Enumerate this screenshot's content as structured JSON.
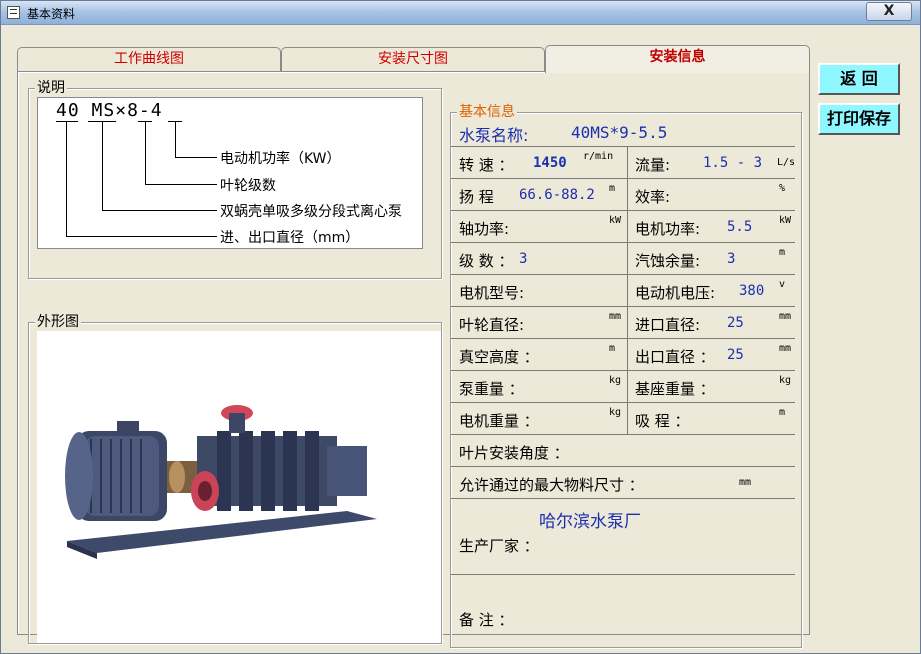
{
  "window": {
    "title": "基本资料",
    "close": "X"
  },
  "tabs": [
    {
      "label": "工作曲线图"
    },
    {
      "label": "安装尺寸图"
    },
    {
      "label": "安装信息"
    }
  ],
  "explain": {
    "label": "说明",
    "model": {
      "code_parts": [
        "40",
        "MS",
        "×",
        "8",
        "-",
        "4"
      ],
      "legend": [
        "电动机功率（KW）",
        "叶轮级数",
        "双蜗壳单吸多级分段式离心泵",
        "进、出口直径（mm）"
      ]
    }
  },
  "outline": {
    "label": "外形图"
  },
  "info": {
    "label": "基本信息",
    "pump_name_label": "水泵名称:",
    "pump_name_value": "40MS*9-5.5",
    "rows": [
      {
        "l_label": "转 速 ：",
        "l_value": "1450",
        "l_unit": "r/min",
        "r_label": "流量:",
        "r_value": "1.5 - 3",
        "r_unit": "L/s"
      },
      {
        "l_label": "扬 程",
        "l_value": "66.6-88.2",
        "l_unit": "m",
        "r_label": "效率:",
        "r_value": "",
        "r_unit": "%"
      },
      {
        "l_label": "轴功率:",
        "l_value": "",
        "l_unit": "kW",
        "r_label": "电机功率:",
        "r_value": "5.5",
        "r_unit": "kW"
      },
      {
        "l_label": "级 数 ：",
        "l_value": "3",
        "l_unit": "",
        "r_label": "汽蚀余量:",
        "r_value": "3",
        "r_unit": "m"
      },
      {
        "l_label": "电机型号:",
        "l_value": "",
        "l_unit": "",
        "r_label": "电动机电压:",
        "r_value": "380",
        "r_unit": "v"
      },
      {
        "l_label": "叶轮直径:",
        "l_value": "",
        "l_unit": "mm",
        "r_label": "进口直径:",
        "r_value": "25",
        "r_unit": "mm"
      },
      {
        "l_label": "真空高度 ：",
        "l_value": "",
        "l_unit": "m",
        "r_label": "出口直径 ：",
        "r_value": "25",
        "r_unit": "mm"
      },
      {
        "l_label": "泵重量 ：",
        "l_value": "",
        "l_unit": "kg",
        "r_label": "基座重量 ：",
        "r_value": "",
        "r_unit": "kg"
      },
      {
        "l_label": "电机重量 ：",
        "l_value": "",
        "l_unit": "kg",
        "r_label": "吸 程 ：",
        "r_value": "",
        "r_unit": "m"
      }
    ],
    "blade_angle_label": "叶片安装角度 ：",
    "max_particle_label": "允许通过的最大物料尺寸 ：",
    "max_particle_unit": "mm",
    "manufacturer_value": "哈尔滨水泵厂",
    "manufacturer_label": "生产厂家 ：",
    "remark_label": "备  注 ："
  },
  "buttons": {
    "back": "返  回",
    "print_save": "打印保存"
  },
  "colors": {
    "tab_text": "#d00000",
    "value_text": "#1c2fb0",
    "info_title": "#e06000",
    "button_bg": "#8ff7ff"
  }
}
